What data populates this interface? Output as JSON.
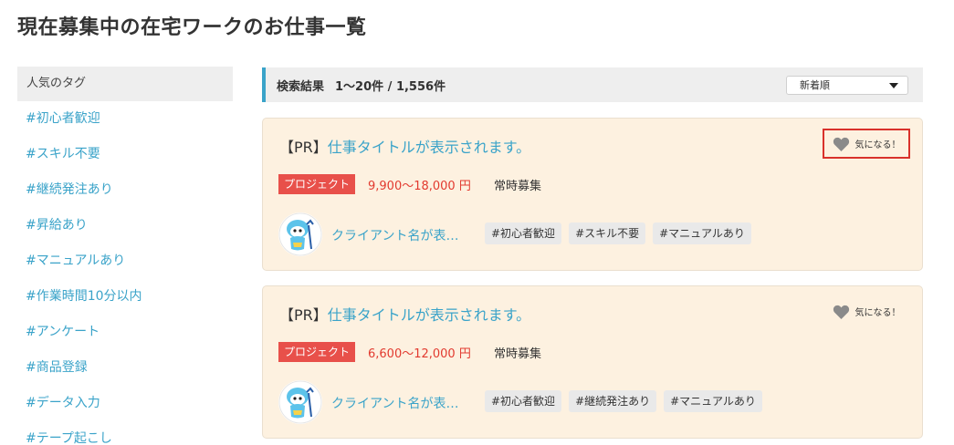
{
  "page": {
    "title": "現在募集中の在宅ワークのお仕事一覧"
  },
  "sidebar": {
    "heading": "人気のタグ",
    "tags": [
      "#初心者歓迎",
      "#スキル不要",
      "#継続発注あり",
      "#昇給あり",
      "#マニュアルあり",
      "#作業時間10分以内",
      "#アンケート",
      "#商品登録",
      "#データ入力",
      "#テープ起こし"
    ]
  },
  "results": {
    "label": "検索結果",
    "count": "1～20件 / 1,556件",
    "sort": {
      "selected": "新着順"
    }
  },
  "jobs": [
    {
      "pr": "【PR】",
      "title": "仕事タイトルが表示されます。",
      "favorite_label": "気になる！",
      "type": "プロジェクト",
      "price": "9,900～18,000 円",
      "recruit": "常時募集",
      "client": "クライアント名が表…",
      "tags": [
        "#初心者歓迎",
        "#スキル不要",
        "#マニュアルあり"
      ]
    },
    {
      "pr": "【PR】",
      "title": "仕事タイトルが表示されます。",
      "favorite_label": "気になる！",
      "type": "プロジェクト",
      "price": "6,600～12,000 円",
      "recruit": "常時募集",
      "client": "クライアント名が表…",
      "tags": [
        "#初心者歓迎",
        "#継続発注あり",
        "#マニュアルあり"
      ]
    }
  ],
  "colors": {
    "accent": "#3aa3c9",
    "price": "#e23a2f",
    "badge": "#e8504a",
    "card_bg": "#fdf1e0",
    "highlight_border": "#d9312b"
  },
  "icons": {
    "favorite": "heart-icon",
    "sort": "caret-down-icon",
    "avatar": "mascot-avatar"
  }
}
